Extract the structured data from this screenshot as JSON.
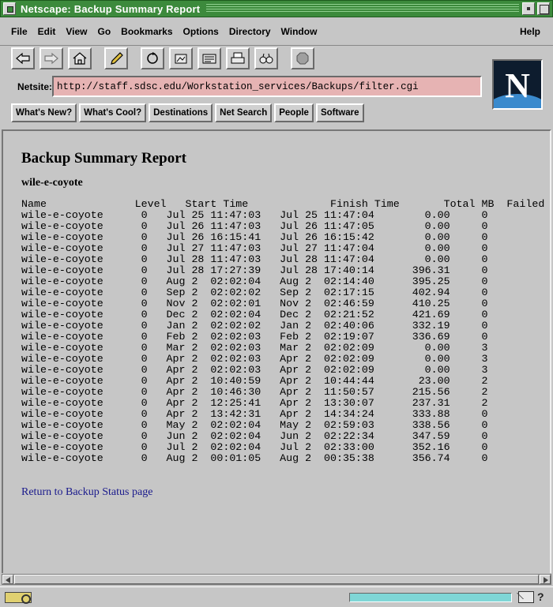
{
  "window": {
    "title": "Netscape: Backup Summary Report"
  },
  "menu": [
    "File",
    "Edit",
    "View",
    "Go",
    "Bookmarks",
    "Options",
    "Directory",
    "Window"
  ],
  "help_label": "Help",
  "toolbar_icons": [
    "back-icon",
    "forward-icon",
    "home-icon",
    "edit-icon",
    "reload-icon",
    "images-icon",
    "open-icon",
    "print-icon",
    "find-icon",
    "stop-icon"
  ],
  "location": {
    "label": "Netsite:",
    "url": "http://staff.sdsc.edu/Workstation_services/Backups/filter.cgi"
  },
  "directory_buttons": [
    "What's New?",
    "What's Cool?",
    "Destinations",
    "Net Search",
    "People",
    "Software"
  ],
  "logo": {
    "letter": "N"
  },
  "report": {
    "title": "Backup Summary Report",
    "host": "wile-e-coyote",
    "columns": [
      "Name",
      "Level",
      "Start Time",
      "Finish Time",
      "Total MB",
      "Failed"
    ],
    "rows": [
      [
        "wile-e-coyote",
        "0",
        "Jul 25 11:47:03",
        "Jul 25 11:47:04",
        "0.00",
        "0"
      ],
      [
        "wile-e-coyote",
        "0",
        "Jul 26 11:47:03",
        "Jul 26 11:47:05",
        "0.00",
        "0"
      ],
      [
        "wile-e-coyote",
        "0",
        "Jul 26 16:15:41",
        "Jul 26 16:15:42",
        "0.00",
        "0"
      ],
      [
        "wile-e-coyote",
        "0",
        "Jul 27 11:47:03",
        "Jul 27 11:47:04",
        "0.00",
        "0"
      ],
      [
        "wile-e-coyote",
        "0",
        "Jul 28 11:47:03",
        "Jul 28 11:47:04",
        "0.00",
        "0"
      ],
      [
        "wile-e-coyote",
        "0",
        "Jul 28 17:27:39",
        "Jul 28 17:40:14",
        "396.31",
        "0"
      ],
      [
        "wile-e-coyote",
        "0",
        "Aug 2  02:02:04",
        "Aug 2  02:14:40",
        "395.25",
        "0"
      ],
      [
        "wile-e-coyote",
        "0",
        "Sep 2  02:02:02",
        "Sep 2  02:17:15",
        "402.94",
        "0"
      ],
      [
        "wile-e-coyote",
        "0",
        "Nov 2  02:02:01",
        "Nov 2  02:46:59",
        "410.25",
        "0"
      ],
      [
        "wile-e-coyote",
        "0",
        "Dec 2  02:02:04",
        "Dec 2  02:21:52",
        "421.69",
        "0"
      ],
      [
        "wile-e-coyote",
        "0",
        "Jan 2  02:02:02",
        "Jan 2  02:40:06",
        "332.19",
        "0"
      ],
      [
        "wile-e-coyote",
        "0",
        "Feb 2  02:02:03",
        "Feb 2  02:19:07",
        "336.69",
        "0"
      ],
      [
        "wile-e-coyote",
        "0",
        "Mar 2  02:02:03",
        "Mar 2  02:02:09",
        "0.00",
        "3"
      ],
      [
        "wile-e-coyote",
        "0",
        "Apr 2  02:02:03",
        "Apr 2  02:02:09",
        "0.00",
        "3"
      ],
      [
        "wile-e-coyote",
        "0",
        "Apr 2  02:02:03",
        "Apr 2  02:02:09",
        "0.00",
        "3"
      ],
      [
        "wile-e-coyote",
        "0",
        "Apr 2  10:40:59",
        "Apr 2  10:44:44",
        "23.00",
        "2"
      ],
      [
        "wile-e-coyote",
        "0",
        "Apr 2  10:46:30",
        "Apr 2  11:50:57",
        "215.56",
        "2"
      ],
      [
        "wile-e-coyote",
        "0",
        "Apr 2  12:25:41",
        "Apr 2  13:30:07",
        "237.31",
        "2"
      ],
      [
        "wile-e-coyote",
        "0",
        "Apr 2  13:42:31",
        "Apr 2  14:34:24",
        "333.88",
        "0"
      ],
      [
        "wile-e-coyote",
        "0",
        "May 2  02:02:04",
        "May 2  02:59:03",
        "338.56",
        "0"
      ],
      [
        "wile-e-coyote",
        "0",
        "Jun 2  02:02:04",
        "Jun 2  02:22:34",
        "347.59",
        "0"
      ],
      [
        "wile-e-coyote",
        "0",
        "Jul 2  02:02:04",
        "Jul 2  02:33:00",
        "352.16",
        "0"
      ],
      [
        "wile-e-coyote",
        "0",
        "Aug 2  00:01:05",
        "Aug 2  00:35:38",
        "356.74",
        "0"
      ]
    ],
    "return_link": "Return to Backup Status page"
  },
  "status_icons": [
    "security-icon",
    "mail-icon",
    "question-icon"
  ]
}
